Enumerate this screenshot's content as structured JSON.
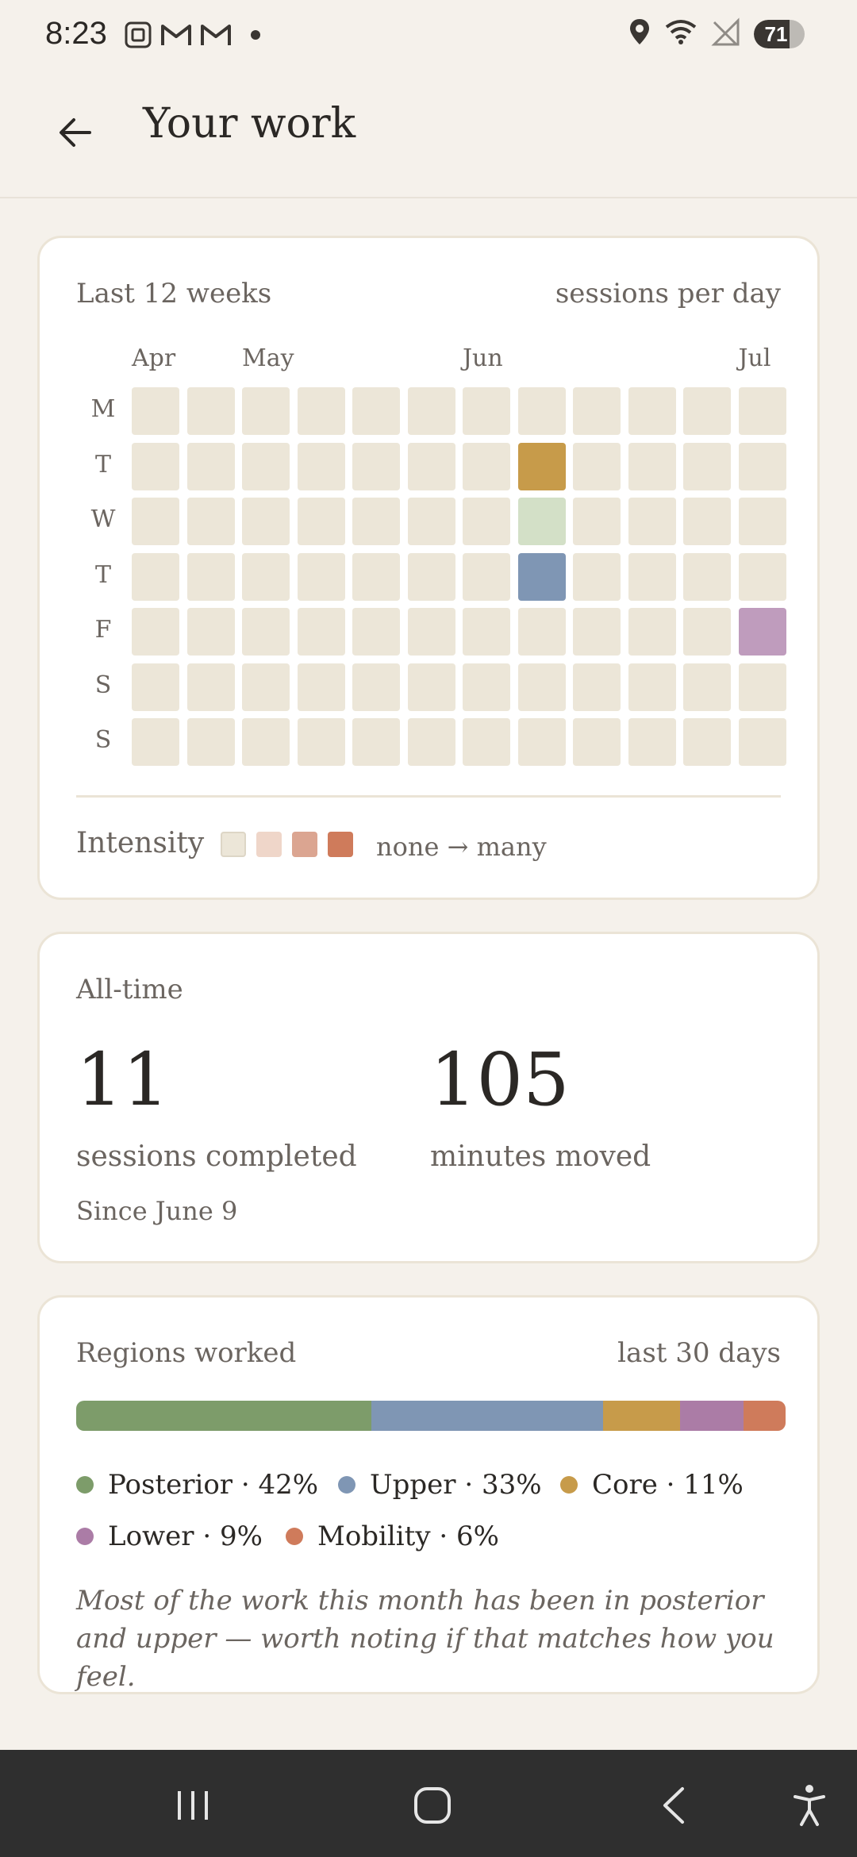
{
  "status_bar": {
    "time": "8:23",
    "battery": "71",
    "battery_level": 0.71
  },
  "app_bar": {
    "title": "Your work"
  },
  "activity": {
    "heading": "Last 12 weeks",
    "meta": "sessions per day",
    "months": [
      "Apr",
      "May",
      "Jun",
      "Jul"
    ],
    "month_week_index": [
      0,
      2,
      6,
      11
    ],
    "days": [
      "M",
      "T",
      "W",
      "T",
      "F",
      "S",
      "S"
    ],
    "weeks": 12,
    "highlighted_cells": [
      {
        "week": 7,
        "day": 1,
        "color": "#c79b4a"
      },
      {
        "week": 7,
        "day": 2,
        "color": "#d3e0c7"
      },
      {
        "week": 7,
        "day": 3,
        "color": "#7f96b4"
      },
      {
        "week": 11,
        "day": 4,
        "color": "#bf9cbd"
      }
    ],
    "empty_color": "#ece6d8",
    "intensity_label": "Intensity",
    "intensity_swatches": [
      "#ece6d8",
      "#efd6c9",
      "#dba591",
      "#cf7b5b"
    ],
    "intensity_range": "none → many"
  },
  "all_time": {
    "heading": "All-time",
    "sessions": "11",
    "sessions_label": "sessions completed",
    "minutes": "105",
    "minutes_label": "minutes moved",
    "since": "Since June 9"
  },
  "regions": {
    "heading": "Regions worked",
    "meta": "last 30 days",
    "items": [
      {
        "label": "Posterior · 42%",
        "value": 42,
        "color": "#7d9c6a"
      },
      {
        "label": "Upper · 33%",
        "value": 33,
        "color": "#7f96b4"
      },
      {
        "label": "Core · 11%",
        "value": 11,
        "color": "#c79b4a"
      },
      {
        "label": "Lower · 9%",
        "value": 9,
        "color": "#ab7ca6"
      },
      {
        "label": "Mobility · 6%",
        "value": 6,
        "color": "#cf7b5b"
      }
    ],
    "note": "Most of the work this month has been in posterior and upper — worth noting if that matches how you feel."
  },
  "nav": {
    "icons": [
      "recent-apps-icon",
      "home-icon",
      "back-icon",
      "accessibility-icon"
    ]
  }
}
